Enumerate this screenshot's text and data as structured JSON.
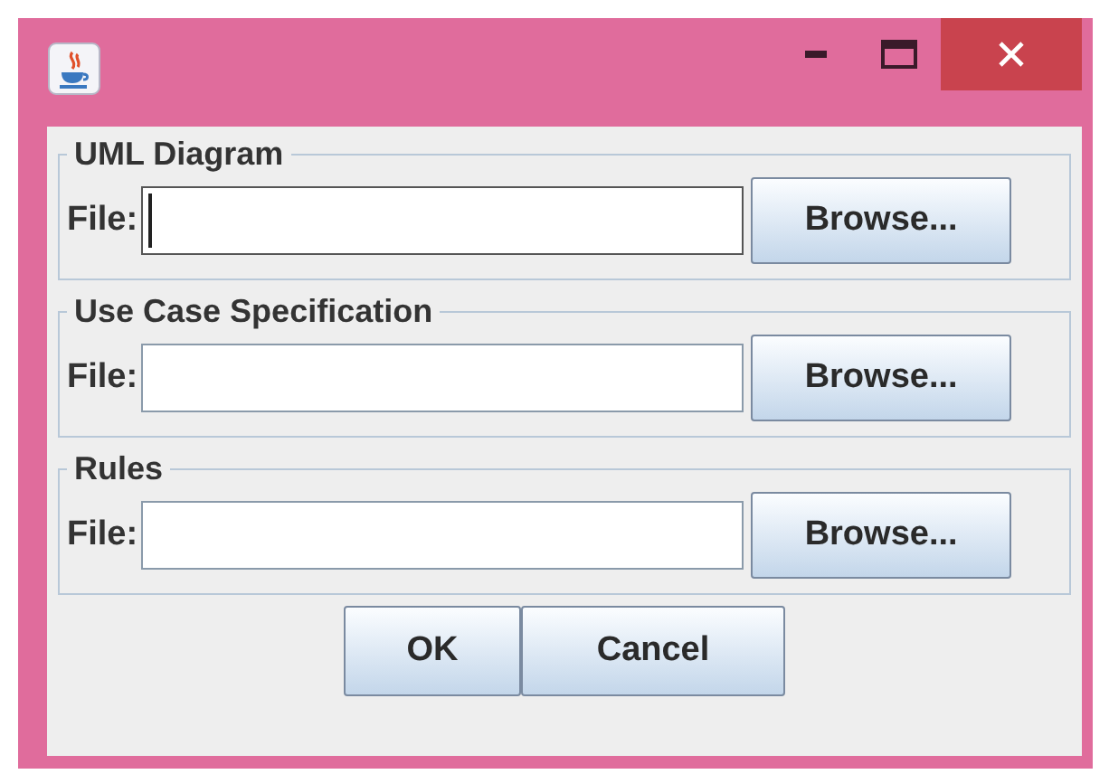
{
  "window": {
    "controls": [
      {
        "kind": "minimize"
      },
      {
        "kind": "maximize"
      },
      {
        "kind": "close"
      }
    ]
  },
  "groups": [
    {
      "title": "UML Diagram",
      "label": "File:",
      "focused": true,
      "button": "Browse..."
    },
    {
      "title": "Use Case Specification",
      "label": "File:",
      "focused": false,
      "button": "Browse..."
    },
    {
      "title": "Rules",
      "label": "File:",
      "focused": false,
      "button": "Browse..."
    }
  ],
  "buttons": [
    "OK",
    "Cancel"
  ]
}
